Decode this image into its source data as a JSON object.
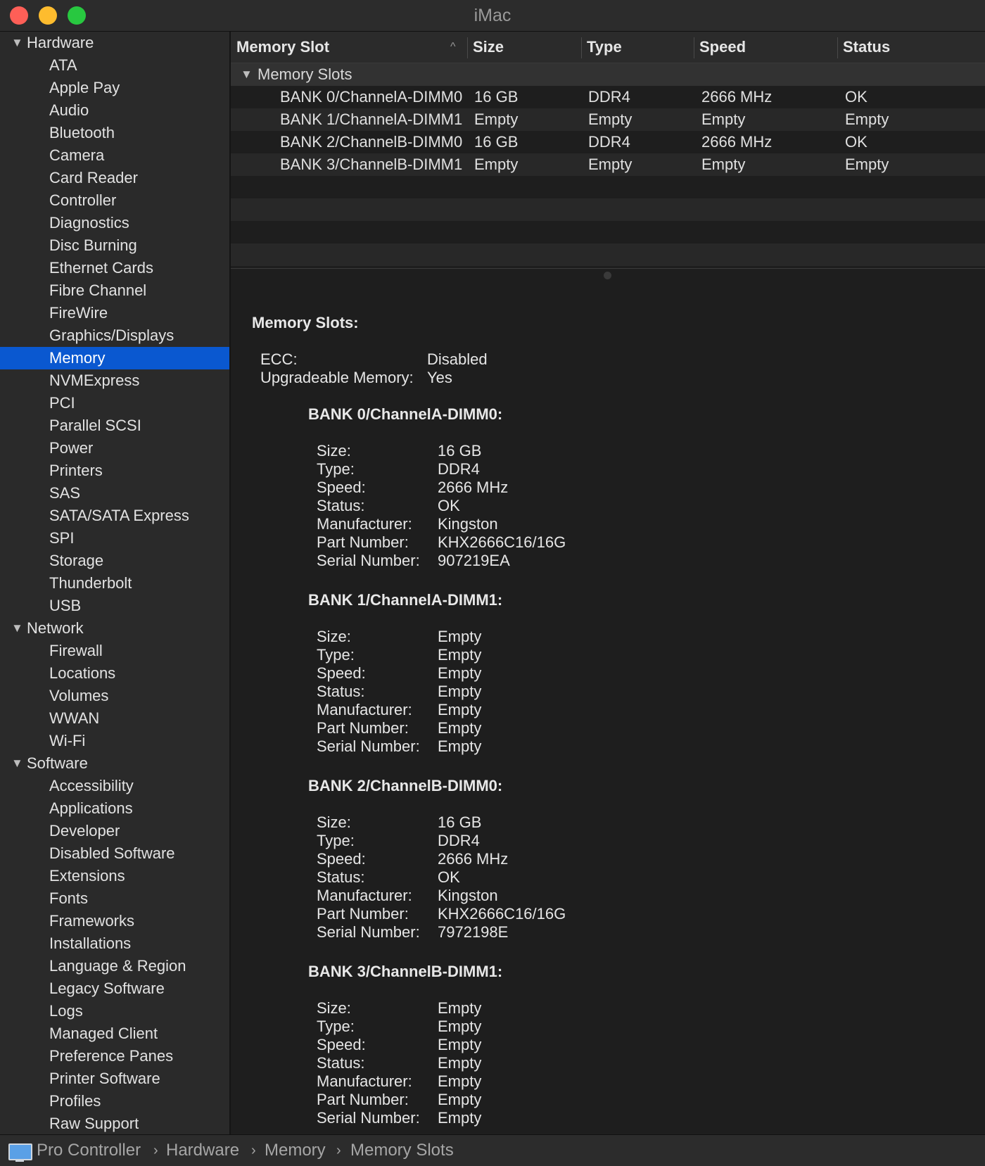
{
  "window": {
    "title": "iMac"
  },
  "sidebar": {
    "groups": [
      {
        "label": "Hardware",
        "items": [
          "ATA",
          "Apple Pay",
          "Audio",
          "Bluetooth",
          "Camera",
          "Card Reader",
          "Controller",
          "Diagnostics",
          "Disc Burning",
          "Ethernet Cards",
          "Fibre Channel",
          "FireWire",
          "Graphics/Displays",
          "Memory",
          "NVMExpress",
          "PCI",
          "Parallel SCSI",
          "Power",
          "Printers",
          "SAS",
          "SATA/SATA Express",
          "SPI",
          "Storage",
          "Thunderbolt",
          "USB"
        ]
      },
      {
        "label": "Network",
        "items": [
          "Firewall",
          "Locations",
          "Volumes",
          "WWAN",
          "Wi-Fi"
        ]
      },
      {
        "label": "Software",
        "items": [
          "Accessibility",
          "Applications",
          "Developer",
          "Disabled Software",
          "Extensions",
          "Fonts",
          "Frameworks",
          "Installations",
          "Language & Region",
          "Legacy Software",
          "Logs",
          "Managed Client",
          "Preference Panes",
          "Printer Software",
          "Profiles",
          "Raw Support"
        ]
      }
    ],
    "selected": "Memory"
  },
  "table": {
    "columns": [
      "Memory Slot",
      "Size",
      "Type",
      "Speed",
      "Status"
    ],
    "group_label": "Memory Slots",
    "rows": [
      [
        "BANK 0/ChannelA-DIMM0",
        "16 GB",
        "DDR4",
        "2666 MHz",
        "OK"
      ],
      [
        "BANK 1/ChannelA-DIMM1",
        "Empty",
        "Empty",
        "Empty",
        "Empty"
      ],
      [
        "BANK 2/ChannelB-DIMM0",
        "16 GB",
        "DDR4",
        "2666 MHz",
        "OK"
      ],
      [
        "BANK 3/ChannelB-DIMM1",
        "Empty",
        "Empty",
        "Empty",
        "Empty"
      ]
    ]
  },
  "detail": {
    "heading": "Memory Slots:",
    "summary": [
      {
        "label": "ECC:",
        "value": "Disabled"
      },
      {
        "label": "Upgradeable Memory:",
        "value": "Yes"
      }
    ],
    "banks": [
      {
        "title": "BANK 0/ChannelA-DIMM0:",
        "fields": [
          {
            "label": "Size:",
            "value": "16 GB"
          },
          {
            "label": "Type:",
            "value": "DDR4"
          },
          {
            "label": "Speed:",
            "value": "2666 MHz"
          },
          {
            "label": "Status:",
            "value": "OK"
          },
          {
            "label": "Manufacturer:",
            "value": "Kingston"
          },
          {
            "label": "Part Number:",
            "value": "KHX2666C16/16G"
          },
          {
            "label": "Serial Number:",
            "value": "907219EA"
          }
        ]
      },
      {
        "title": "BANK 1/ChannelA-DIMM1:",
        "fields": [
          {
            "label": "Size:",
            "value": "Empty"
          },
          {
            "label": "Type:",
            "value": "Empty"
          },
          {
            "label": "Speed:",
            "value": "Empty"
          },
          {
            "label": "Status:",
            "value": "Empty"
          },
          {
            "label": "Manufacturer:",
            "value": "Empty"
          },
          {
            "label": "Part Number:",
            "value": "Empty"
          },
          {
            "label": "Serial Number:",
            "value": "Empty"
          }
        ]
      },
      {
        "title": "BANK 2/ChannelB-DIMM0:",
        "fields": [
          {
            "label": "Size:",
            "value": "16 GB"
          },
          {
            "label": "Type:",
            "value": "DDR4"
          },
          {
            "label": "Speed:",
            "value": "2666 MHz"
          },
          {
            "label": "Status:",
            "value": "OK"
          },
          {
            "label": "Manufacturer:",
            "value": "Kingston"
          },
          {
            "label": "Part Number:",
            "value": "KHX2666C16/16G"
          },
          {
            "label": "Serial Number:",
            "value": "7972198E"
          }
        ]
      },
      {
        "title": "BANK 3/ChannelB-DIMM1:",
        "fields": [
          {
            "label": "Size:",
            "value": "Empty"
          },
          {
            "label": "Type:",
            "value": "Empty"
          },
          {
            "label": "Speed:",
            "value": "Empty"
          },
          {
            "label": "Status:",
            "value": "Empty"
          },
          {
            "label": "Manufacturer:",
            "value": "Empty"
          },
          {
            "label": "Part Number:",
            "value": "Empty"
          },
          {
            "label": "Serial Number:",
            "value": "Empty"
          }
        ]
      }
    ]
  },
  "breadcrumb": [
    "Pro Controller",
    "Hardware",
    "Memory",
    "Memory Slots"
  ],
  "colors": {
    "selection": "#0a58d0",
    "background": "#1e1e1e",
    "sidebar": "#2a2a2a"
  },
  "icons": {
    "computer": "imac-icon",
    "disclosure": "disclosure-triangle-icon",
    "sort": "sort-ascending-icon"
  }
}
